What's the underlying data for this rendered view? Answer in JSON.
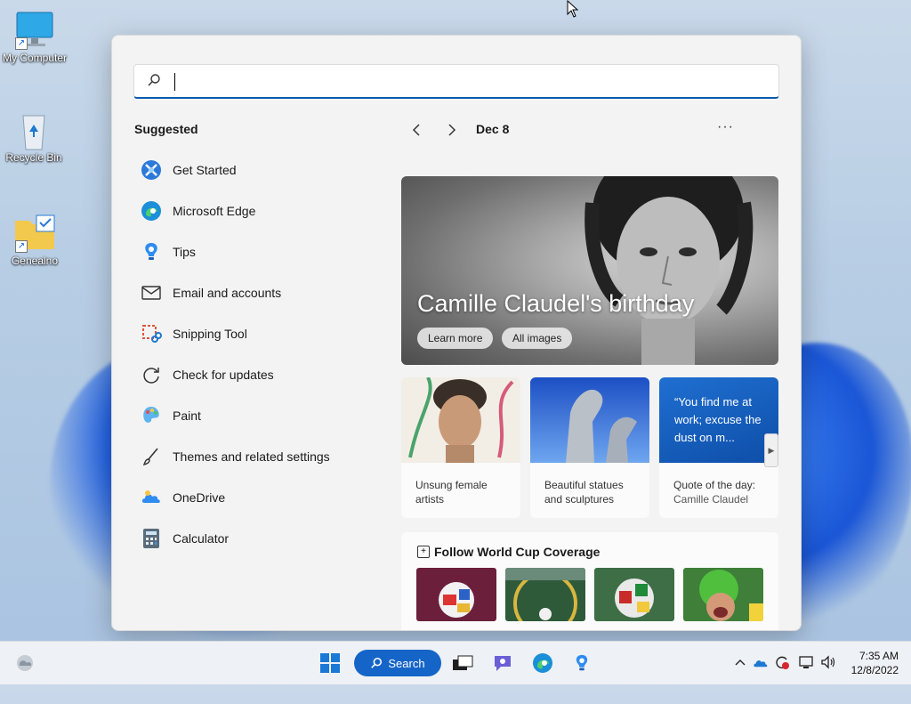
{
  "desktop": {
    "icons": [
      {
        "label": "My Computer",
        "icon": "monitor-icon"
      },
      {
        "label": "Recycle Bin",
        "icon": "recycle-bin-icon"
      },
      {
        "label": "Genealno",
        "icon": "folder-icon"
      }
    ]
  },
  "start_menu": {
    "search": {
      "value": "",
      "placeholder": ""
    },
    "suggested_title": "Suggested",
    "apps": [
      {
        "label": "Get Started",
        "icon": "get-started-icon"
      },
      {
        "label": "Microsoft Edge",
        "icon": "edge-icon"
      },
      {
        "label": "Tips",
        "icon": "tips-icon"
      },
      {
        "label": "Email and accounts",
        "icon": "mail-icon"
      },
      {
        "label": "Snipping Tool",
        "icon": "snipping-tool-icon"
      },
      {
        "label": "Check for updates",
        "icon": "refresh-icon"
      },
      {
        "label": "Paint",
        "icon": "paint-icon"
      },
      {
        "label": "Themes and related settings",
        "icon": "brush-icon"
      },
      {
        "label": "OneDrive",
        "icon": "onedrive-icon"
      },
      {
        "label": "Calculator",
        "icon": "calculator-icon"
      }
    ],
    "highlights": {
      "date": "Dec 8",
      "more": "···",
      "hero": {
        "title": "Camille Claudel's birthday",
        "learn_more": "Learn more",
        "all_images": "All images"
      },
      "cards": [
        {
          "line1": "Unsung female",
          "line2": "artists"
        },
        {
          "line1": "Beautiful statues",
          "line2": "and sculptures"
        },
        {
          "quote": "“You find me at work; excuse the dust on m...",
          "line1": "Quote of the day:",
          "line2": "Camille Claudel"
        }
      ],
      "world_cup": {
        "title": "Follow World Cup Coverage"
      }
    }
  },
  "taskbar": {
    "search_label": "Search",
    "time": "7:35 AM",
    "date": "12/8/2022"
  },
  "colors": {
    "accent": "#0b5cad",
    "search_button": "#1565c8"
  }
}
